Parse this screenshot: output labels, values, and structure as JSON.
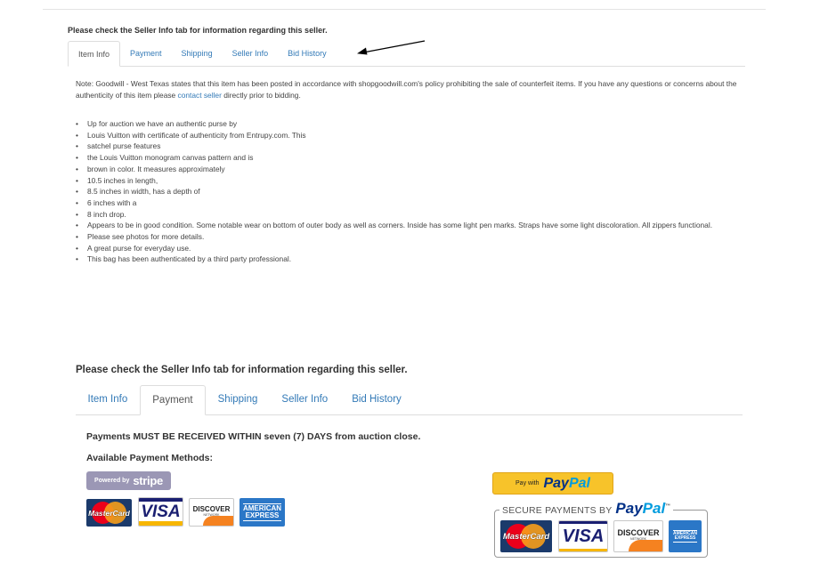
{
  "notice": "Please check the Seller Info tab for information regarding this seller.",
  "tabs": [
    "Item Info",
    "Payment",
    "Shipping",
    "Seller Info",
    "Bid History"
  ],
  "item_info": {
    "note_prefix": "Note: Goodwill - West Texas states that this item has been posted in accordance with shopgoodwill.com's policy prohibiting the sale of counterfeit items. If you have any questions or concerns about the authenticity of this item please ",
    "note_link": "contact seller",
    "note_suffix": " directly prior to bidding.",
    "bullets": [
      "Up for auction we have an authentic purse by",
      "Louis Vuitton with certificate of authenticity from Entrupy.com. This",
      "satchel purse features",
      "the Louis Vuitton monogram canvas pattern and is",
      "brown in color. It measures approximately",
      "10.5 inches in length,",
      "8.5 inches in width, has a depth of",
      "6 inches with a",
      "8 inch drop.",
      "Appears to be in good condition. Some notable wear on bottom of outer body as well as corners. Inside has some light pen marks. Straps have some light discoloration. All zippers functional.",
      "Please see photos for more details.",
      "A great purse for everyday use.",
      "This bag has been authenticated by a third party professional."
    ]
  },
  "payment": {
    "headline": "Payments MUST BE RECEIVED WITHIN seven (7) DAYS from auction close.",
    "methods_label": "Available Payment Methods:",
    "stripe_powered": "Powered by",
    "stripe_name": "stripe",
    "cards": {
      "mastercard": "MasterCard",
      "visa": "VISA",
      "discover": "DISCOVER",
      "discover_sub": "NETWORK",
      "amex_line1": "AMERICAN",
      "amex_line2": "EXPRESS"
    },
    "paypal_button_prefix": "Pay with",
    "paypal_pay": "Pay",
    "paypal_pal": "Pal",
    "secure_label": "SECURE PAYMENTS BY",
    "secure_tm": "™"
  },
  "colors": {
    "link": "#337ab7",
    "paypal_yellow": "#f7c32a",
    "paypal_navy": "#003087",
    "paypal_blue": "#009cde",
    "stripe_badge": "#9b97b5",
    "amex_blue": "#2b77c7"
  },
  "icons": {
    "annotation": "arrow-left-icon",
    "bullet": "bullet-icon"
  }
}
